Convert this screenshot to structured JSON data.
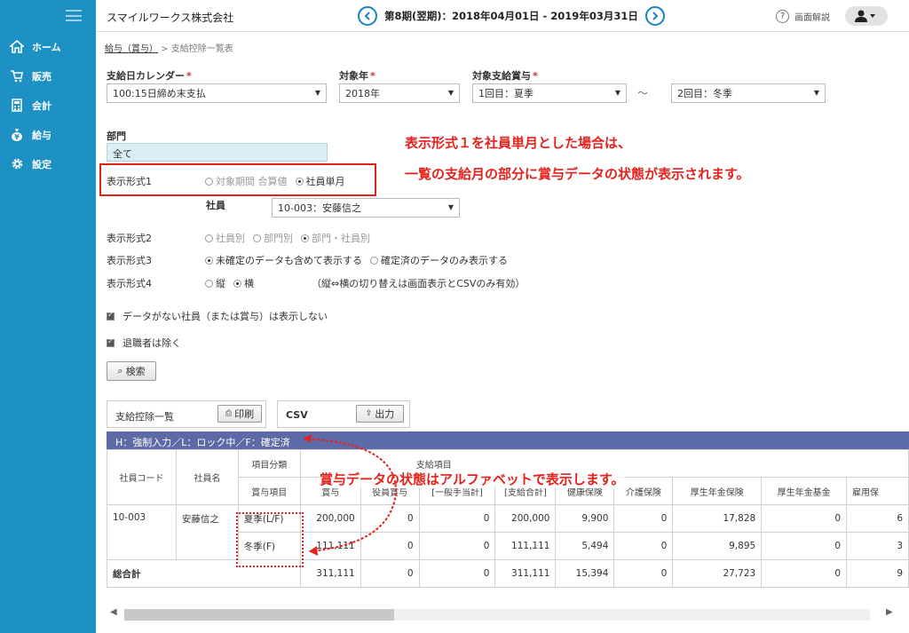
{
  "sidebar": {
    "items": [
      {
        "label": "ホーム",
        "icon": "home-icon"
      },
      {
        "label": "販売",
        "icon": "cart-icon"
      },
      {
        "label": "会計",
        "icon": "calculator-icon"
      },
      {
        "label": "給与",
        "icon": "money-bag-icon"
      },
      {
        "label": "設定",
        "icon": "gear-icon"
      }
    ]
  },
  "header": {
    "company": "スマイルワークス株式会社",
    "period": "第8期(翌期)：2018年04月01日 - 2019年03月31日",
    "help": "画面解説"
  },
  "breadcrumb": {
    "parent": "給与（賞与）",
    "separator": " > ",
    "current": "支給控除一覧表"
  },
  "form": {
    "calendar_label": "支給日カレンダー",
    "calendar_value": "100:15日締め末支払",
    "year_label": "対象年",
    "year_value": "2018年",
    "bonus_label": "対象支給賞与",
    "bonus_from": "1回目：夏季",
    "tilde": "～",
    "bonus_to": "2回目：冬季",
    "required_mark": "*",
    "dept_label": "部門",
    "dept_value": "全て",
    "format1_label": "表示形式1",
    "format1_opt1": "対象期間 合算値",
    "format1_opt2": "社員単月",
    "employee_label": "社員",
    "employee_value": "10-003：安藤信之",
    "format2_label": "表示形式2",
    "format2_opt1": "社員別",
    "format2_opt2": "部門別",
    "format2_opt3": "部門・社員別",
    "format3_label": "表示形式3",
    "format3_opt1": "未確定のデータも含めて表示する",
    "format3_opt2": "確定済のデータのみ表示する",
    "format4_label": "表示形式4",
    "format4_opt1": "縦",
    "format4_opt2": "横",
    "format4_note": "（縦⇔横の切り替えは画面表示とCSVのみ有効）",
    "check1": "データがない社員（または賞与）は表示しない",
    "check2": "退職者は除く",
    "search_button": "検索"
  },
  "panels": {
    "list_label": "支給控除一覧",
    "print_button": "印刷",
    "csv_label": "CSV",
    "export_button": "出力"
  },
  "annotations": {
    "line1": "表示形式１を社員単月とした場合は、",
    "line2": "一覧の支給月の部分に賞与データの状態が表示されます。",
    "line3": "賞与データの状態はアルファベットで表示します。"
  },
  "table": {
    "legend": "H：強制入力／L：ロック中／F：確定済",
    "h_code": "社員コード",
    "h_name": "社員名",
    "h_cat": "項目分類",
    "h_item": "賞与項目",
    "h_group": "支給項目",
    "cols": [
      "賞与",
      "役員賞与",
      "[一般手当計]",
      "[支給合計]",
      "健康保険",
      "介護保険",
      "厚生年金保険",
      "厚生年金基金",
      "雇用保"
    ],
    "row_code": "10-003",
    "row_name": "安藤信之",
    "rows": [
      {
        "item": "夏季(L/F)",
        "values": [
          "200,000",
          "0",
          "0",
          "200,000",
          "9,900",
          "0",
          "17,828",
          "0",
          "6"
        ]
      },
      {
        "item": "冬季(F)",
        "values": [
          "111,111",
          "0",
          "0",
          "111,111",
          "5,494",
          "0",
          "9,895",
          "0",
          "3"
        ]
      }
    ],
    "total_label": "総合計",
    "total_values": [
      "311,111",
      "0",
      "0",
      "311,111",
      "15,394",
      "0",
      "27,723",
      "0",
      "9"
    ]
  },
  "colors": {
    "sidebar": "#1d90c4",
    "accent_red": "#e3221c",
    "table_header": "#5c6ba7"
  }
}
